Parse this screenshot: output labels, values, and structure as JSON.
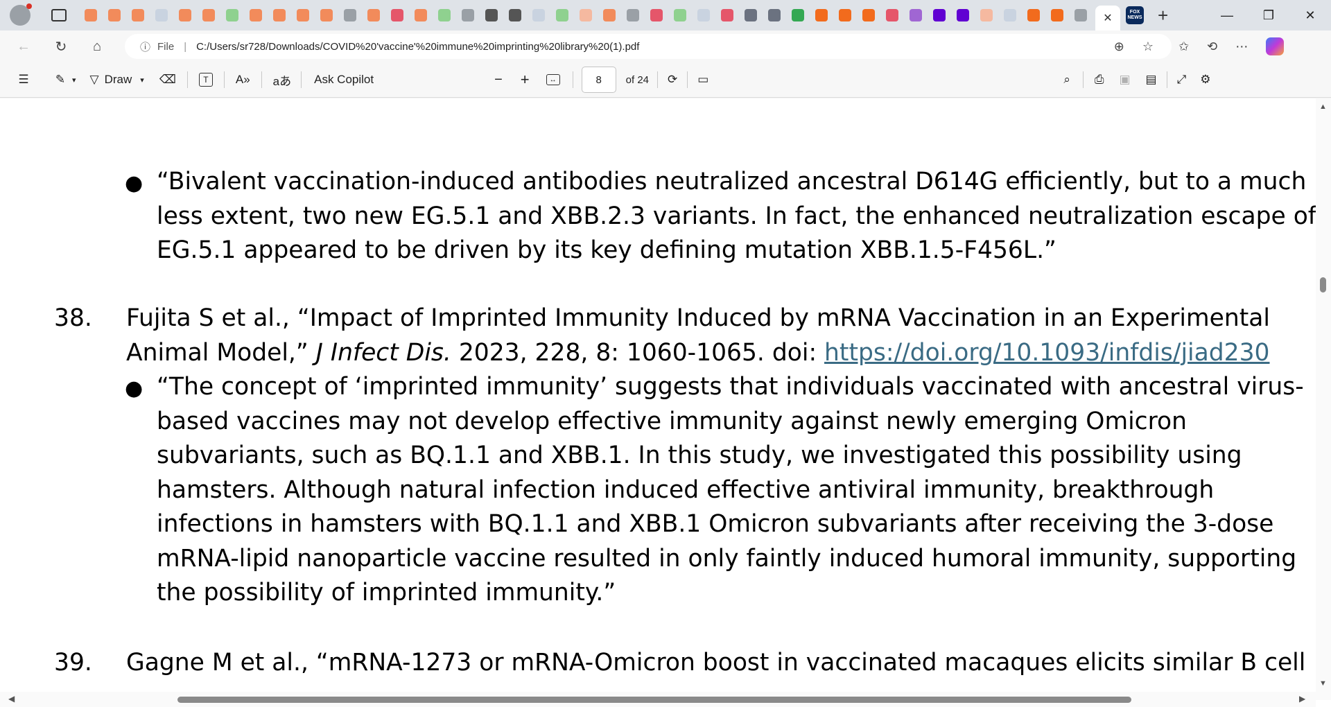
{
  "browser": {
    "tabs": [
      {
        "icon": "bookmark-icon",
        "color": "#f28b5b"
      },
      {
        "icon": "bookmark-icon",
        "color": "#f28b5b"
      },
      {
        "icon": "bookmark-icon",
        "color": "#f28b5b"
      },
      {
        "icon": "web-icon",
        "color": "#c9d3e0"
      },
      {
        "icon": "bookmark-icon",
        "color": "#f28b5b"
      },
      {
        "icon": "bookmark-icon",
        "color": "#f28b5b"
      },
      {
        "icon": "play-icon",
        "color": "#8fd18f"
      },
      {
        "icon": "bookmark-icon",
        "color": "#f28b5b"
      },
      {
        "icon": "bookmark-icon",
        "color": "#f28b5b"
      },
      {
        "icon": "bookmark-icon",
        "color": "#f28b5b"
      },
      {
        "icon": "bookmark-icon",
        "color": "#f28b5b"
      },
      {
        "icon": "news-icon",
        "color": "#9aa0a6"
      },
      {
        "icon": "bookmark-icon",
        "color": "#f28b5b"
      },
      {
        "icon": "video-icon",
        "color": "#e5566a"
      },
      {
        "icon": "bookmark-icon",
        "color": "#f28b5b"
      },
      {
        "icon": "play-icon",
        "color": "#8fd18f"
      },
      {
        "icon": "search-icon",
        "color": "#9aa0a6"
      },
      {
        "icon": "logo-icon",
        "color": "#555555"
      },
      {
        "icon": "diamond-icon",
        "color": "#555555"
      },
      {
        "icon": "web-icon",
        "color": "#c9d3e0"
      },
      {
        "icon": "play-icon",
        "color": "#8fd18f"
      },
      {
        "icon": "bookmark-icon",
        "color": "#f5b9a0"
      },
      {
        "icon": "e-icon",
        "color": "#f28b5b"
      },
      {
        "icon": "bird-icon",
        "color": "#9aa0a6"
      },
      {
        "icon": "r-icon",
        "color": "#e5566a"
      },
      {
        "icon": "play-icon",
        "color": "#8fd18f"
      },
      {
        "icon": "web-icon",
        "color": "#c9d3e0"
      },
      {
        "icon": "video-icon",
        "color": "#e5566a"
      },
      {
        "icon": "news-icon",
        "color": "#6b7280"
      },
      {
        "icon": "gp-icon",
        "color": "#6b7280"
      },
      {
        "icon": "owl-icon",
        "color": "#34a853"
      },
      {
        "icon": "bookmark-icon",
        "color": "#f26b1d"
      },
      {
        "icon": "bookmark-icon",
        "color": "#f26b1d"
      },
      {
        "icon": "bookmark-icon",
        "color": "#f26b1d"
      },
      {
        "icon": "video-icon",
        "color": "#e5566a"
      },
      {
        "icon": "yahoo-icon",
        "color": "#a066d3"
      },
      {
        "icon": "yahoo-icon",
        "color": "#6001d2"
      },
      {
        "icon": "mail-icon",
        "color": "#6001d2"
      },
      {
        "icon": "bookmark-icon",
        "color": "#f5b9a0"
      },
      {
        "icon": "web-icon",
        "color": "#c9d3e0"
      },
      {
        "icon": "bookmark-icon",
        "color": "#f26b1d"
      },
      {
        "icon": "bookmark-icon",
        "color": "#f26b1d"
      },
      {
        "icon": "ze-icon",
        "color": "#9aa0a6"
      }
    ],
    "active_tab_close": "✕",
    "last_tab_label": "FOX NEWS",
    "new_tab": "+",
    "window_controls": {
      "minimize": "—",
      "restore": "❐",
      "close": "✕"
    }
  },
  "address_bar": {
    "file_label": "File",
    "url": "C:/Users/sr728/Downloads/COVID%20'vaccine'%20immune%20imprinting%20library%20(1).pdf"
  },
  "pdf_toolbar": {
    "draw_label": "Draw",
    "ask_copilot_label": "Ask Copilot",
    "current_page": "8",
    "page_total": "of 24"
  },
  "document": {
    "item37_bullet": {
      "lines": [
        "“Bivalent vaccination-induced antibodies neutralized ancestral D614G efficiently, but to a much",
        "less extent, two new EG.5.1 and XBB.2.3 variants. In fact, the enhanced neutralization escape of",
        "EG.5.1 appeared to be driven by its key defining mutation XBB.1.5-F456L.”"
      ]
    },
    "item38": {
      "number": "38.",
      "line1": "Fujita S et al., “Impact of Imprinted Immunity Induced by mRNA Vaccination in an Experimental",
      "line2_pre": "Animal Model,” ",
      "journal": "J Infect Dis.",
      "line2_post": " 2023, 228, 8: 1060-1065. doi: ",
      "doi_link": "https://doi.org/10.1093/infdis/jiad230",
      "bullet_lines": [
        "“The concept of ‘imprinted immunity’ suggests that individuals vaccinated with ancestral virus-",
        "based vaccines may not develop effective immunity against newly emerging Omicron",
        "subvariants, such as BQ.1.1 and XBB.1. In this study, we investigated this possibility using",
        "hamsters. Although natural infection induced effective antiviral immunity, breakthrough",
        "infections in hamsters with BQ.1.1 and XBB.1 Omicron subvariants after receiving the 3-dose",
        "mRNA-lipid nanoparticle vaccine resulted in only faintly induced humoral immunity, supporting",
        "the possibility of imprinted immunity.”"
      ]
    },
    "item39": {
      "number": "39.",
      "line1": "Gagne M et al., “mRNA-1273 or mRNA-Omicron boost in vaccinated macaques elicits similar B cell"
    },
    "bullet_glyph": "●"
  }
}
